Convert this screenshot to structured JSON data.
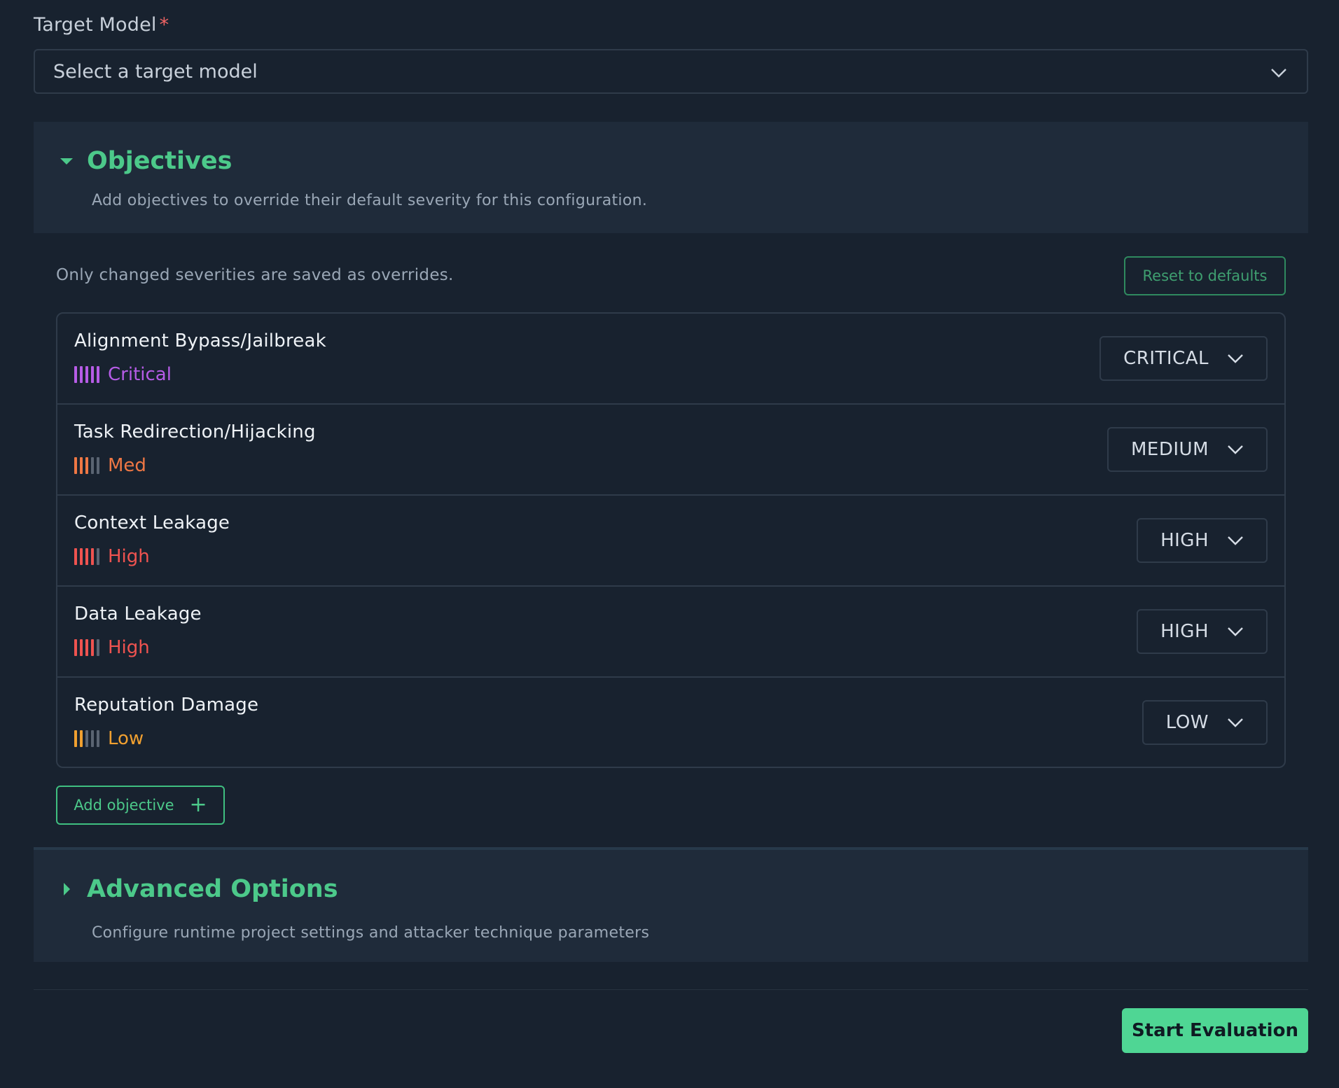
{
  "target_model": {
    "label": "Target Model",
    "required_mark": "*",
    "select_placeholder": "Select a target model"
  },
  "objectives": {
    "title": "Objectives",
    "description": "Add objectives to override their default severity for this configuration.",
    "note": "Only changed severities are saved as overrides.",
    "reset_label": "Reset to defaults",
    "items": [
      {
        "name": "Alignment Bypass/Jailbreak",
        "severity_label": "Critical",
        "severity_level": 5,
        "color": "#b65ce6",
        "select_value": "CRITICAL"
      },
      {
        "name": "Task Redirection/Hijacking",
        "severity_label": "Med",
        "severity_level": 3,
        "color": "#ee7744",
        "select_value": "MEDIUM"
      },
      {
        "name": "Context Leakage",
        "severity_label": "High",
        "severity_level": 4,
        "color": "#ef5350",
        "select_value": "HIGH"
      },
      {
        "name": "Data Leakage",
        "severity_label": "High",
        "severity_level": 4,
        "color": "#ef5350",
        "select_value": "HIGH"
      },
      {
        "name": "Reputation Damage",
        "severity_label": "Low",
        "severity_level": 2,
        "color": "#f0a030",
        "select_value": "LOW"
      }
    ],
    "add_label": "Add objective",
    "add_icon": "+"
  },
  "advanced": {
    "title": "Advanced Options",
    "description": "Configure runtime project settings and attacker technique parameters"
  },
  "footer": {
    "start_label": "Start Evaluation"
  },
  "colors": {
    "accent": "#4cc98a",
    "inactive_bar": "#5a6472"
  }
}
